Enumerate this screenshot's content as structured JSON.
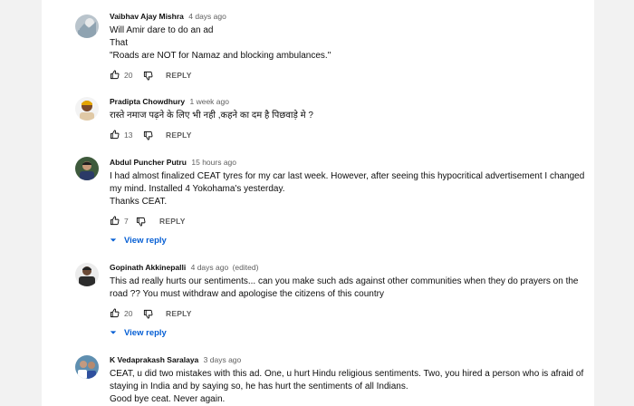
{
  "comments": [
    {
      "author": "Vaibhav Ajay Mishra",
      "time": "4 days ago",
      "edited": "",
      "lines": [
        "Will Amir dare to do an ad",
        "That",
        "\"Roads are NOT for Namaz and blocking ambulances.\""
      ],
      "likes": "20",
      "reply_label": "REPLY",
      "view_reply": ""
    },
    {
      "author": "Pradipta Chowdhury",
      "time": "1 week ago",
      "edited": "",
      "lines": [
        "रास्ते नमाज पढ़ने के लिए भी नही  ,कहने का दम है पिछवाड़े मे  ?"
      ],
      "likes": "13",
      "reply_label": "REPLY",
      "view_reply": ""
    },
    {
      "author": "Abdul Puncher Putru",
      "time": "15 hours ago",
      "edited": "",
      "lines": [
        "I had almost finalized CEAT tyres for my car last week. However, after seeing this hypocritical advertisement I changed",
        "my mind. Installed 4 Yokohama's yesterday.",
        "Thanks CEAT."
      ],
      "likes": "7",
      "reply_label": "REPLY",
      "view_reply": "View reply"
    },
    {
      "author": "Gopinath Akkinepalli",
      "time": "4 days ago",
      "edited": "(edited)",
      "lines": [
        "This ad really hurts our sentiments... can you make such ads against other communities when they do prayers on the",
        "road ?? You must withdraw and apologise the citizens of this country"
      ],
      "likes": "20",
      "reply_label": "REPLY",
      "view_reply": "View reply"
    },
    {
      "author": "K Vedaprakash Saralaya",
      "time": "3 days ago",
      "edited": "",
      "lines": [
        "CEAT, u did two mistakes with this ad. One, u hurt Hindu religious sentiments. Two, you hired a person who is afraid of",
        "staying in India and by saying so, he has hurt the sentiments of all Indians.",
        "Good bye ceat. Never again."
      ],
      "likes": "",
      "reply_label": "",
      "view_reply": ""
    }
  ]
}
